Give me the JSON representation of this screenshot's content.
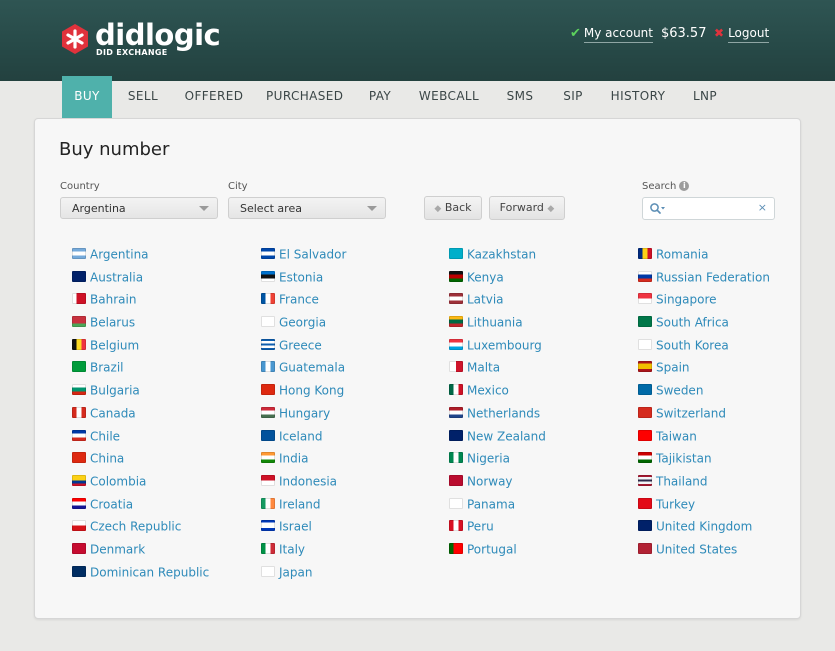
{
  "brand": {
    "name": "didlogic",
    "tagline": "DID EXCHANGE",
    "accent": "#e0323c"
  },
  "account": {
    "label": "My account",
    "balance": "$63.57",
    "logout": "Logout"
  },
  "nav": {
    "active_color": "#4fb1ab",
    "items": [
      "BUY",
      "SELL",
      "OFFERED",
      "PURCHASED",
      "PAY",
      "WEBCALL",
      "SMS",
      "SIP",
      "HISTORY",
      "LNP"
    ],
    "active": "BUY"
  },
  "page": {
    "title": "Buy number",
    "country_label": "Country",
    "country_value": "Argentina",
    "city_label": "City",
    "city_value": "Select area",
    "back_label": "Back",
    "forward_label": "Forward",
    "search_label": "Search",
    "search_value": "",
    "clear_symbol": "×"
  },
  "link_color": "#2e8ab9",
  "countries": [
    [
      {
        "name": "Argentina",
        "flag": "h:#75aadb,#ffffff,#75aadb"
      },
      {
        "name": "Australia",
        "flag": "s:#012169"
      },
      {
        "name": "Bahrain",
        "flag": "v:#ffffff,#ce1126,#ce1126"
      },
      {
        "name": "Belarus",
        "flag": "h:#c8313e,#c8313e,#4aa657"
      },
      {
        "name": "Belgium",
        "flag": "v:#111111,#fdda24,#ef3340"
      },
      {
        "name": "Brazil",
        "flag": "s:#009c3b"
      },
      {
        "name": "Bulgaria",
        "flag": "h:#ffffff,#00966e,#d62612"
      },
      {
        "name": "Canada",
        "flag": "v:#d52b1e,#ffffff,#d52b1e"
      },
      {
        "name": "Chile",
        "flag": "h:#0039a6,#ffffff,#d52b1e"
      },
      {
        "name": "China",
        "flag": "s:#de2910"
      },
      {
        "name": "Colombia",
        "flag": "h:#fcd116,#fcd116,#003893,#ce1126"
      },
      {
        "name": "Croatia",
        "flag": "h:#ff0000,#ffffff,#171796"
      },
      {
        "name": "Czech Republic",
        "flag": "h:#ffffff,#d7141a"
      },
      {
        "name": "Denmark",
        "flag": "s:#c60c30"
      },
      {
        "name": "Dominican Republic",
        "flag": "s:#002d62"
      }
    ],
    [
      {
        "name": "El Salvador",
        "flag": "h:#0047ab,#ffffff,#0047ab"
      },
      {
        "name": "Estonia",
        "flag": "h:#0072ce,#111111,#ffffff"
      },
      {
        "name": "France",
        "flag": "v:#0055a4,#ffffff,#ef4135"
      },
      {
        "name": "Georgia",
        "flag": "s:#ffffff"
      },
      {
        "name": "Greece",
        "flag": "h:#0d5eaf,#ffffff,#0d5eaf,#ffffff,#0d5eaf"
      },
      {
        "name": "Guatemala",
        "flag": "v:#4997d0,#ffffff,#4997d0"
      },
      {
        "name": "Hong Kong",
        "flag": "s:#de2910"
      },
      {
        "name": "Hungary",
        "flag": "h:#ce2939,#ffffff,#477050"
      },
      {
        "name": "Iceland",
        "flag": "s:#02529c"
      },
      {
        "name": "India",
        "flag": "h:#ff9933,#ffffff,#138808"
      },
      {
        "name": "Indonesia",
        "flag": "h:#ce1126,#ffffff"
      },
      {
        "name": "Ireland",
        "flag": "v:#169b62,#ffffff,#ff883e"
      },
      {
        "name": "Israel",
        "flag": "h:#0038b8,#ffffff,#ffffff,#0038b8"
      },
      {
        "name": "Italy",
        "flag": "v:#009246,#ffffff,#ce2b37"
      },
      {
        "name": "Japan",
        "flag": "s:#ffffff"
      }
    ],
    [
      {
        "name": "Kazakhstan",
        "flag": "s:#00afca"
      },
      {
        "name": "Kenya",
        "flag": "h:#111111,#bb0000,#006600"
      },
      {
        "name": "Latvia",
        "flag": "h:#9e3039,#ffffff,#9e3039"
      },
      {
        "name": "Lithuania",
        "flag": "h:#fdb913,#006a44,#c1272d"
      },
      {
        "name": "Luxembourg",
        "flag": "h:#ef3340,#ffffff,#00a3e0"
      },
      {
        "name": "Malta",
        "flag": "v:#ffffff,#cf142b"
      },
      {
        "name": "Mexico",
        "flag": "v:#006847,#ffffff,#ce1126"
      },
      {
        "name": "Netherlands",
        "flag": "h:#ae1c28,#ffffff,#21468b"
      },
      {
        "name": "New Zealand",
        "flag": "s:#012169"
      },
      {
        "name": "Nigeria",
        "flag": "v:#008751,#ffffff,#008751"
      },
      {
        "name": "Norway",
        "flag": "s:#ba0c2f"
      },
      {
        "name": "Panama",
        "flag": "s:#ffffff"
      },
      {
        "name": "Peru",
        "flag": "v:#d91023,#ffffff,#d91023"
      },
      {
        "name": "Portugal",
        "flag": "v:#006600,#ff0000,#ff0000"
      }
    ],
    [
      {
        "name": "Romania",
        "flag": "v:#002b7f,#fcd116,#ce1126"
      },
      {
        "name": "Russian Federation",
        "flag": "h:#ffffff,#0039a6,#d52b1e"
      },
      {
        "name": "Singapore",
        "flag": "h:#ef3340,#ffffff"
      },
      {
        "name": "South Africa",
        "flag": "s:#007749"
      },
      {
        "name": "South Korea",
        "flag": "s:#ffffff"
      },
      {
        "name": "Spain",
        "flag": "h:#aa151b,#f1bf00,#f1bf00,#aa151b"
      },
      {
        "name": "Sweden",
        "flag": "s:#006aa7"
      },
      {
        "name": "Switzerland",
        "flag": "s:#d52b1e"
      },
      {
        "name": "Taiwan",
        "flag": "s:#fe0000"
      },
      {
        "name": "Tajikistan",
        "flag": "h:#cc0000,#ffffff,#006600"
      },
      {
        "name": "Thailand",
        "flag": "h:#a51931,#f4f5f8,#2d2a4a,#f4f5f8,#a51931"
      },
      {
        "name": "Turkey",
        "flag": "s:#e30a17"
      },
      {
        "name": "United Kingdom",
        "flag": "s:#012169"
      },
      {
        "name": "United States",
        "flag": "s:#b22234"
      }
    ]
  ]
}
